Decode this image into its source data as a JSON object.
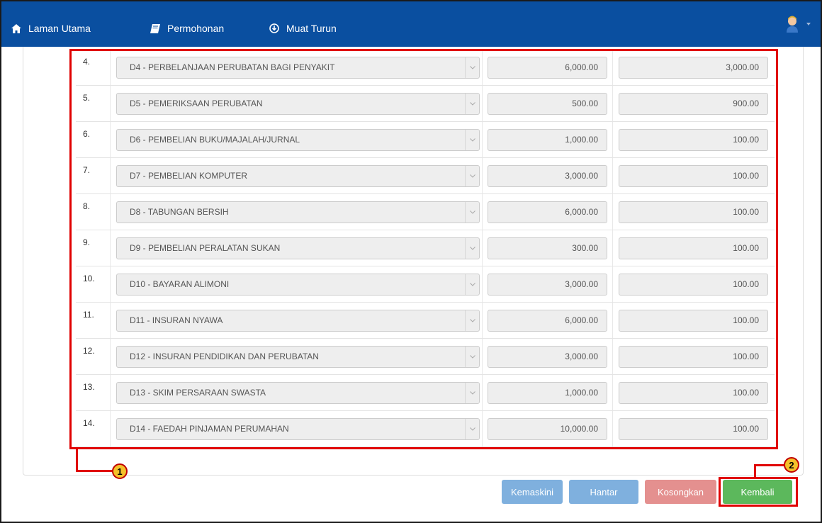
{
  "nav": {
    "home_label": "Laman Utama",
    "application_label": "Permohonan",
    "download_label": "Muat Turun",
    "home_icon": "home-icon",
    "application_icon": "book-icon",
    "download_icon": "download-circle-icon",
    "avatar_icon": "user-avatar-icon"
  },
  "rows": [
    {
      "num": "4.",
      "item": "D4 - PERBELANJAAN PERUBATAN BAGI PENYAKIT",
      "amount1": "6,000.00",
      "amount2": "3,000.00"
    },
    {
      "num": "5.",
      "item": "D5 - PEMERIKSAAN PERUBATAN",
      "amount1": "500.00",
      "amount2": "900.00"
    },
    {
      "num": "6.",
      "item": "D6 - PEMBELIAN BUKU/MAJALAH/JURNAL",
      "amount1": "1,000.00",
      "amount2": "100.00"
    },
    {
      "num": "7.",
      "item": "D7 - PEMBELIAN KOMPUTER",
      "amount1": "3,000.00",
      "amount2": "100.00"
    },
    {
      "num": "8.",
      "item": "D8 - TABUNGAN BERSIH",
      "amount1": "6,000.00",
      "amount2": "100.00"
    },
    {
      "num": "9.",
      "item": "D9 - PEMBELIAN PERALATAN SUKAN",
      "amount1": "300.00",
      "amount2": "100.00"
    },
    {
      "num": "10.",
      "item": "D10 - BAYARAN ALIMONI",
      "amount1": "3,000.00",
      "amount2": "100.00"
    },
    {
      "num": "11.",
      "item": "D11 - INSURAN NYAWA",
      "amount1": "6,000.00",
      "amount2": "100.00"
    },
    {
      "num": "12.",
      "item": "D12 - INSURAN PENDIDIKAN DAN PERUBATAN",
      "amount1": "3,000.00",
      "amount2": "100.00"
    },
    {
      "num": "13.",
      "item": "D13 - SKIM PERSARAAN SWASTA",
      "amount1": "1,000.00",
      "amount2": "100.00"
    },
    {
      "num": "14.",
      "item": "D14 - FAEDAH PINJAMAN PERUMAHAN",
      "amount1": "10,000.00",
      "amount2": "100.00"
    }
  ],
  "buttons": {
    "update_label": "Kemaskini",
    "submit_label": "Hantar",
    "clear_label": "Kosongkan",
    "back_label": "Kembali"
  },
  "callouts": {
    "one": "1",
    "two": "2"
  },
  "colors": {
    "navbar": "#0a4fa0",
    "highlight": "#e00000",
    "primary_disabled": "#7fb0de",
    "danger_disabled": "#e4908f",
    "success": "#5cb85c"
  }
}
